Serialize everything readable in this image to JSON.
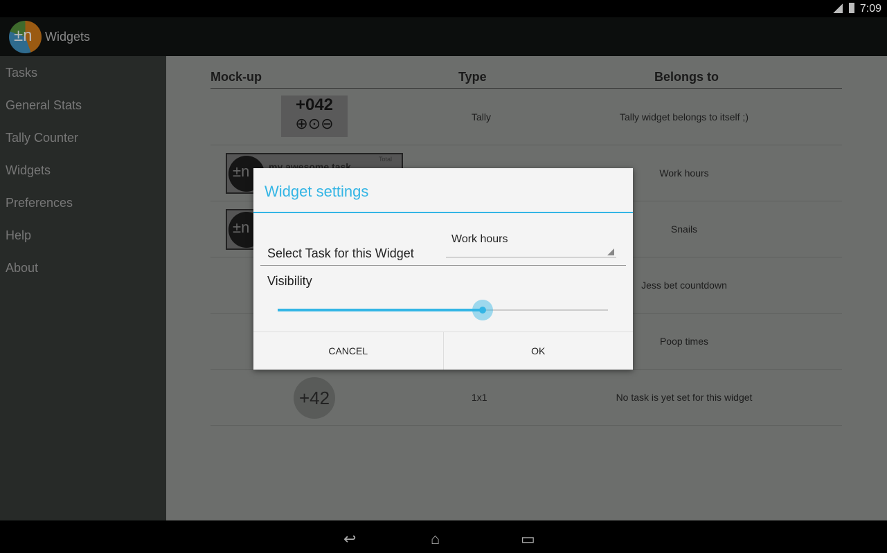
{
  "status_bar": {
    "time": "7:09",
    "network": "3G"
  },
  "action_bar": {
    "title": "Widgets"
  },
  "sidebar": {
    "items": [
      {
        "label": "Tasks"
      },
      {
        "label": "General Stats"
      },
      {
        "label": "Tally Counter"
      },
      {
        "label": "Widgets"
      },
      {
        "label": "Preferences"
      },
      {
        "label": "Help"
      },
      {
        "label": "About"
      }
    ]
  },
  "table": {
    "headers": [
      "Mock-up",
      "Type",
      "Belongs to"
    ],
    "rows": [
      {
        "mockup": "+042",
        "type": "Tally",
        "belongs": "Tally widget belongs to itself ;)"
      },
      {
        "mockup": "my awesome task",
        "mockup_extra": "Total",
        "type": "",
        "belongs": "Work hours"
      },
      {
        "mockup": "",
        "type": "",
        "belongs": "Snails"
      },
      {
        "mockup": "",
        "type": "",
        "belongs": "Jess bet countdown"
      },
      {
        "mockup": "",
        "type": "",
        "belongs": "Poop times"
      },
      {
        "mockup": "+42",
        "type": "1x1",
        "belongs": "No task is yet set for this widget"
      }
    ]
  },
  "dialog": {
    "title": "Widget settings",
    "select_label": "Select Task for this Widget",
    "selected_task": "Work hours",
    "visibility_label": "Visibility",
    "visibility_value": 0.62,
    "cancel": "CANCEL",
    "ok": "OK"
  },
  "colors": {
    "accent": "#33b5e5"
  }
}
